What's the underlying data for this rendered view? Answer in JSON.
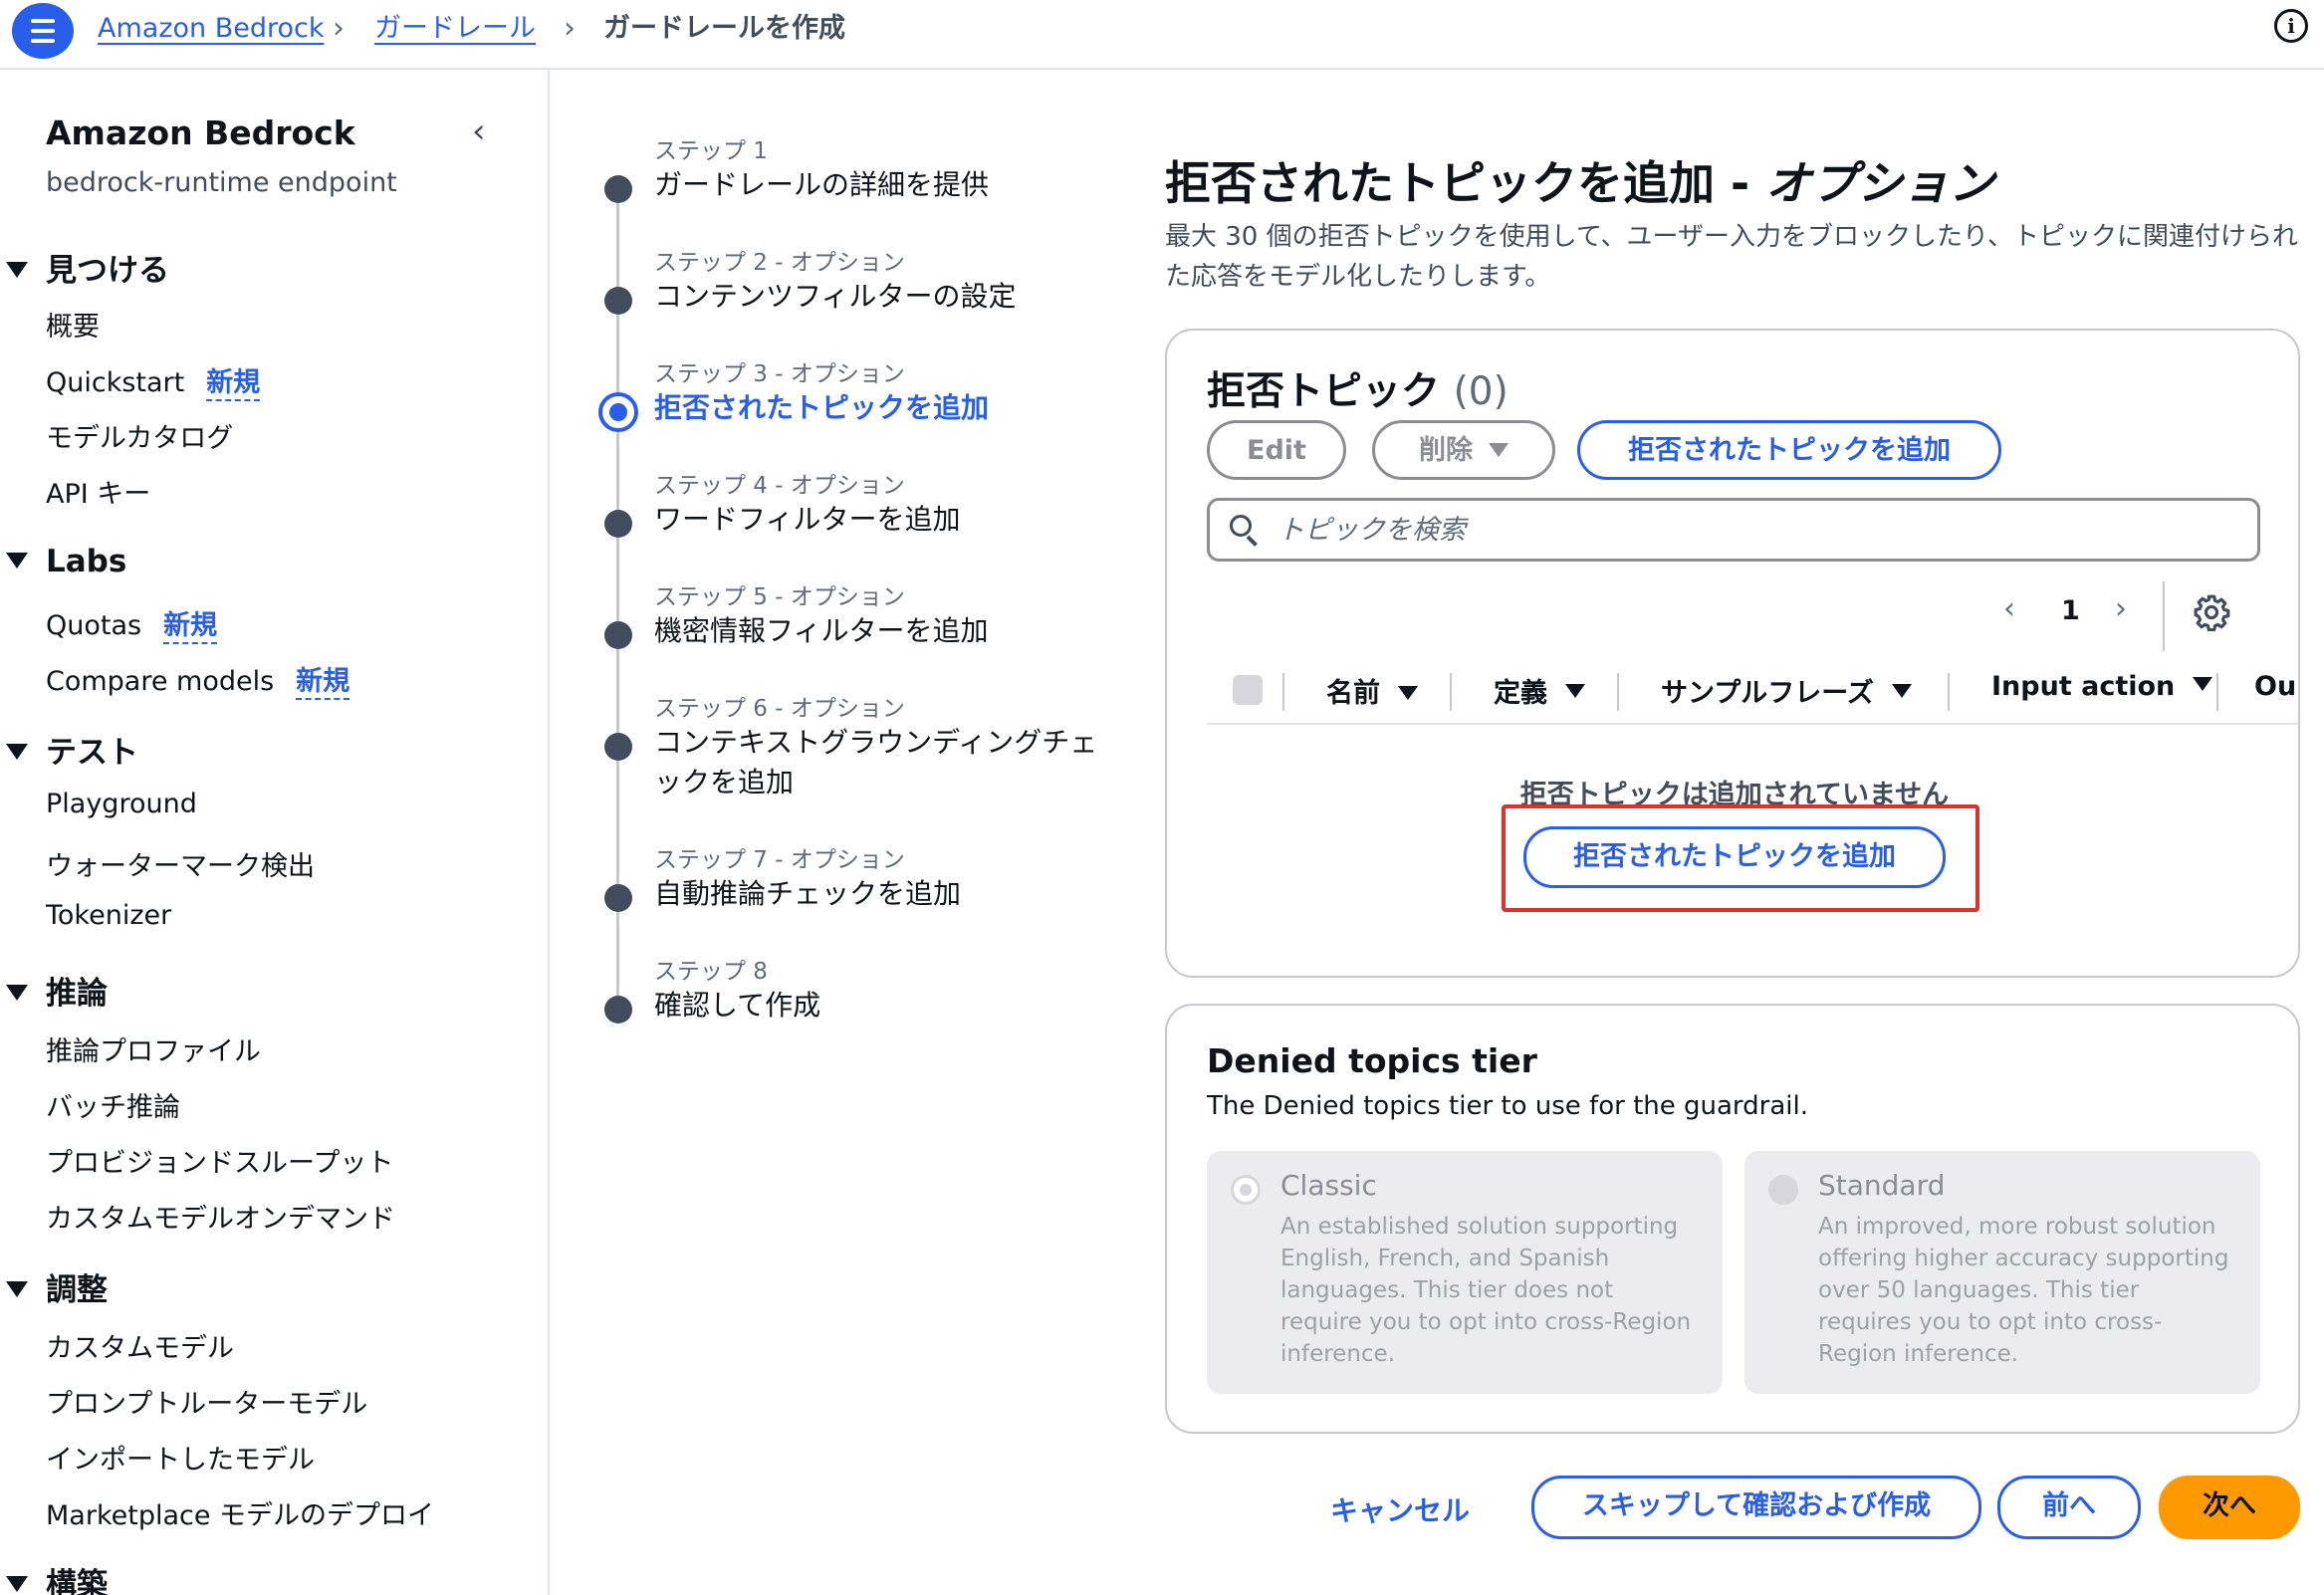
{
  "header": {
    "breadcrumbs": [
      "Amazon Bedrock",
      "ガードレール",
      "ガードレールを作成"
    ]
  },
  "sidebar": {
    "title": "Amazon Bedrock",
    "subtitle": "bedrock-runtime endpoint",
    "new_badge": "新規",
    "sections": [
      {
        "label": "見つける",
        "items": [
          {
            "label": "概要"
          },
          {
            "label": "Quickstart",
            "badge": "新規"
          },
          {
            "label": "モデルカタログ"
          },
          {
            "label": "API キー"
          }
        ]
      },
      {
        "label": "Labs",
        "items": [
          {
            "label": "Quotas",
            "badge": "新規"
          },
          {
            "label": "Compare models",
            "badge": "新規"
          }
        ]
      },
      {
        "label": "テスト",
        "items": [
          {
            "label": "Playground"
          },
          {
            "label": "ウォーターマーク検出"
          },
          {
            "label": "Tokenizer"
          }
        ]
      },
      {
        "label": "推論",
        "items": [
          {
            "label": "推論プロファイル"
          },
          {
            "label": "バッチ推論"
          },
          {
            "label": "プロビジョンドスループット"
          },
          {
            "label": "カスタムモデルオンデマンド"
          }
        ]
      },
      {
        "label": "調整",
        "items": [
          {
            "label": "カスタムモデル"
          },
          {
            "label": "プロンプトルーターモデル"
          },
          {
            "label": "インポートしたモデル"
          },
          {
            "label": "Marketplace モデルのデプロイ"
          }
        ]
      },
      {
        "label": "構築",
        "items": []
      }
    ]
  },
  "steps": [
    {
      "label": "ステップ 1",
      "name": "ガードレールの詳細を提供"
    },
    {
      "label": "ステップ 2 - オプション",
      "name": "コンテンツフィルターの設定"
    },
    {
      "label": "ステップ 3 - オプション",
      "name": "拒否されたトピックを追加",
      "active": true
    },
    {
      "label": "ステップ 4 - オプション",
      "name": "ワードフィルターを追加"
    },
    {
      "label": "ステップ 5 - オプション",
      "name": "機密情報フィルターを追加"
    },
    {
      "label": "ステップ 6 - オプション",
      "name_line1": "コンテキストグラウンディングチェ",
      "name_line2": "ックを追加"
    },
    {
      "label": "ステップ 7 - オプション",
      "name": "自動推論チェックを追加"
    },
    {
      "label": "ステップ 8",
      "name": "確認して作成"
    }
  ],
  "main": {
    "title_main": "拒否されたトピックを追加 - ",
    "title_option": "オプション",
    "description": "最大 30 個の拒否トピックを使用して、ユーザー入力をブロックしたり、トピックに関連付けられた応答をモデル化したりします。"
  },
  "topics_card": {
    "heading": "拒否トピック",
    "count": "(0)",
    "edit_label": "Edit",
    "delete_label": "削除",
    "add_label": "拒否されたトピックを追加",
    "search_placeholder": "トピックを検索",
    "page_number": "1",
    "columns": [
      "名前",
      "定義",
      "サンプルフレーズ",
      "Input action",
      "Ou"
    ],
    "empty_message": "拒否トピックは追加されていません",
    "empty_add_label": "拒否されたトピックを追加"
  },
  "tier_card": {
    "heading": "Denied topics tier",
    "description": "The Denied topics tier to use for the guardrail.",
    "options": [
      {
        "name": "Classic",
        "description": "An established solution supporting English, French, and Spanish languages. This tier does not require you to opt into cross-Region inference."
      },
      {
        "name": "Standard",
        "description": "An improved, more robust solution offering higher accuracy supporting over 50 languages. This tier requires you to opt into cross-Region inference."
      }
    ]
  },
  "footer": {
    "cancel": "キャンセル",
    "skip": "スキップして確認および作成",
    "prev": "前へ",
    "next": "次へ"
  },
  "colors": {
    "accent": "#295eea",
    "primary_button": "#ff9900",
    "highlight": "#d9332b"
  }
}
